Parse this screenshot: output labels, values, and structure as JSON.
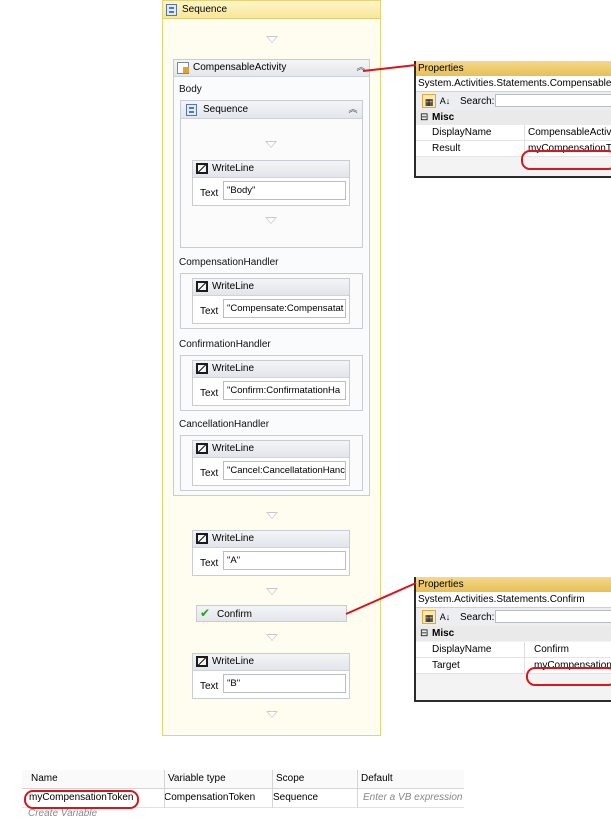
{
  "outer_sequence": {
    "title": "Sequence"
  },
  "compensable_activity": {
    "title": "CompensableActivity",
    "body_label": "Body"
  },
  "body_sequence": {
    "title": "Sequence"
  },
  "body_writeline": {
    "title": "WriteLine",
    "text_label": "Text",
    "value": "\"Body\""
  },
  "handlers": [
    {
      "label": "CompensationHandler",
      "activity": "WriteLine",
      "text_label": "Text",
      "value": "\"Compensate:Compensatat"
    },
    {
      "label": "ConfirmationHandler",
      "activity": "WriteLine",
      "text_label": "Text",
      "value": "\"Confirm:ConfirmatationHa"
    },
    {
      "label": "CancellationHandler",
      "activity": "WriteLine",
      "text_label": "Text",
      "value": "\"Cancel:CancellatationHanc"
    }
  ],
  "writeline_a": {
    "title": "WriteLine",
    "text_label": "Text",
    "value": "\"A\""
  },
  "confirm": {
    "title": "Confirm"
  },
  "writeline_b": {
    "title": "WriteLine",
    "text_label": "Text",
    "value": "\"B\""
  },
  "properties_compensable": {
    "title": "Properties",
    "type_name": "System.Activities.Statements.CompensableA",
    "search_label": "Search:",
    "category": "Misc",
    "rows": [
      {
        "key": "DisplayName",
        "value": "CompensableActivi"
      },
      {
        "key": "Result",
        "value": "myCompensationT"
      }
    ]
  },
  "properties_confirm": {
    "title": "Properties",
    "type_name": "System.Activities.Statements.Confirm",
    "search_label": "Search:",
    "category": "Misc",
    "rows": [
      {
        "key": "DisplayName",
        "value": "Confirm"
      },
      {
        "key": "Target",
        "value": "myCompensation"
      }
    ]
  },
  "variables": {
    "headers": [
      "Name",
      "Variable type",
      "Scope",
      "Default"
    ],
    "row": {
      "name": "myCompensationToken",
      "type": "CompensationToken",
      "scope": "Sequence",
      "default_placeholder": "Enter a VB expression"
    },
    "create_label": "Create Variable"
  },
  "colors": {
    "annotation": "#d8161c",
    "sequence_border": "#e6d27a"
  }
}
